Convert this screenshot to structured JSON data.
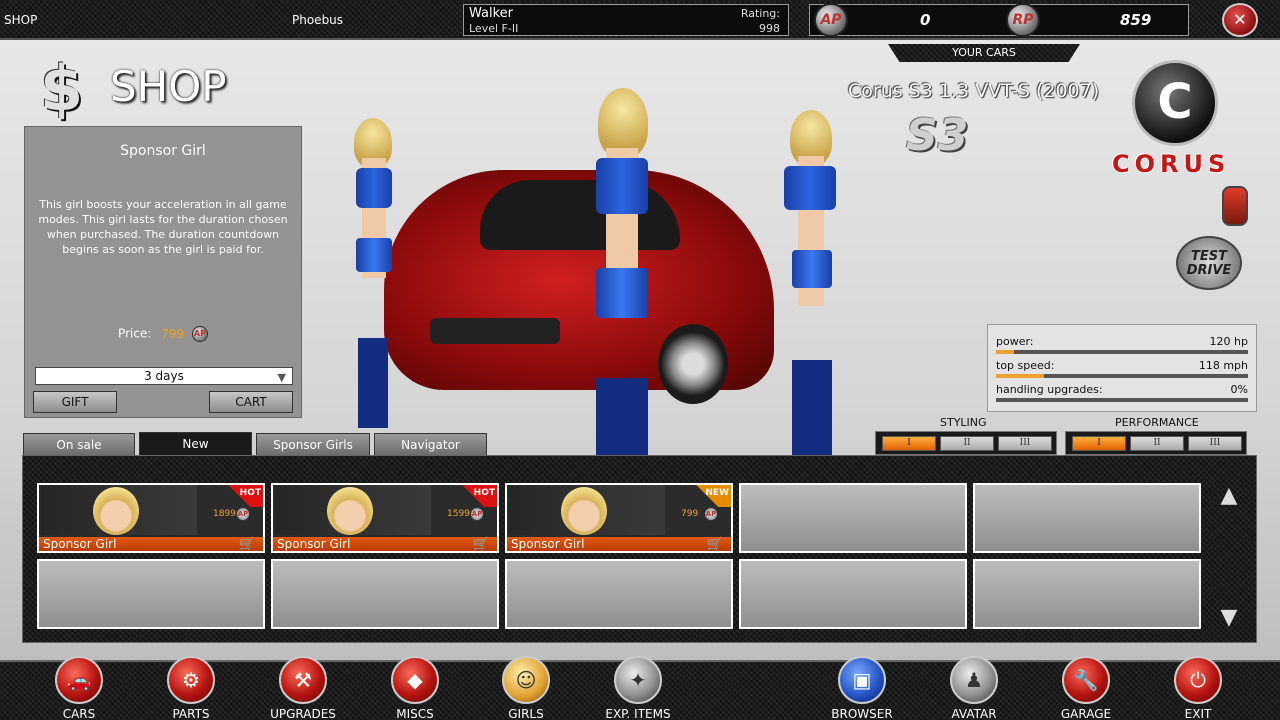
{
  "top_bar": {
    "section": "SHOP",
    "server": "Phoebus",
    "player_name": "Walker",
    "player_level": "Level F-II",
    "rating_label": "Rating:",
    "rating_value": "998",
    "ap_icon": "AP",
    "ap_value": "0",
    "rp_icon": "RP",
    "rp_value": "859",
    "close_icon": "close-icon"
  },
  "your_cars_label": "YOUR CARS",
  "shop": {
    "title": "SHOP",
    "dollar_icon": "$"
  },
  "item": {
    "title": "Sponsor Girl",
    "description": "This girl boosts your acceleration in all game modes.  This girl lasts for the duration chosen when purchased.  The duration countdown begins as soon as the girl is paid for.",
    "price_label": "Price:",
    "price_value": "799",
    "currency_icon": "AP",
    "duration": "3  days",
    "gift_label": "GIFT",
    "cart_label": "CART"
  },
  "car": {
    "name": "Corus S3 1.3 VVT-S (2007)",
    "model_badge": "S3",
    "brand_logo": "C",
    "brand_name": "CORUS",
    "test_drive": "TEST DRIVE"
  },
  "stats": [
    {
      "label": "power:",
      "value": "120 hp",
      "fill": 0.07
    },
    {
      "label": "top speed:",
      "value": "118 mph",
      "fill": 0.19
    },
    {
      "label": "handling upgrades:",
      "value": "0%",
      "fill": 0
    }
  ],
  "styling": {
    "label": "STYLING",
    "levels": [
      "I",
      "II",
      "III"
    ],
    "active": 0
  },
  "performance": {
    "label": "PERFORMANCE",
    "levels": [
      "I",
      "II",
      "III"
    ],
    "active": 0
  },
  "tabs": [
    {
      "label": "On sale",
      "active": false
    },
    {
      "label": "New",
      "active": true
    },
    {
      "label": "Sponsor Girls",
      "active": false
    },
    {
      "label": "Navigator",
      "active": false
    }
  ],
  "grid_items": [
    {
      "name": "Sponsor Girl",
      "price": "1899",
      "badge": "HOT"
    },
    {
      "name": "Sponsor Girl",
      "price": "1599",
      "badge": "HOT"
    },
    {
      "name": "Sponsor Girl",
      "price": "799",
      "badge": "NEW"
    }
  ],
  "bottom_nav": [
    {
      "label": "CARS",
      "icon": "car-icon"
    },
    {
      "label": "PARTS",
      "icon": "parts-icon"
    },
    {
      "label": "UPGRADES",
      "icon": "upgrades-icon"
    },
    {
      "label": "MISCS",
      "icon": "miscs-icon"
    },
    {
      "label": "GIRLS",
      "icon": "girl-icon"
    },
    {
      "label": "EXP. ITEMS",
      "icon": "exp-items-icon"
    },
    {
      "label": "BROWSER",
      "icon": "browser-icon"
    },
    {
      "label": "AVATAR",
      "icon": "avatar-icon"
    },
    {
      "label": "GARAGE",
      "icon": "garage-icon"
    },
    {
      "label": "EXIT",
      "icon": "exit-icon"
    }
  ],
  "colors": {
    "accent_orange": "#e25a10",
    "brand_red": "#c21818",
    "price_gold": "#f0a030"
  }
}
